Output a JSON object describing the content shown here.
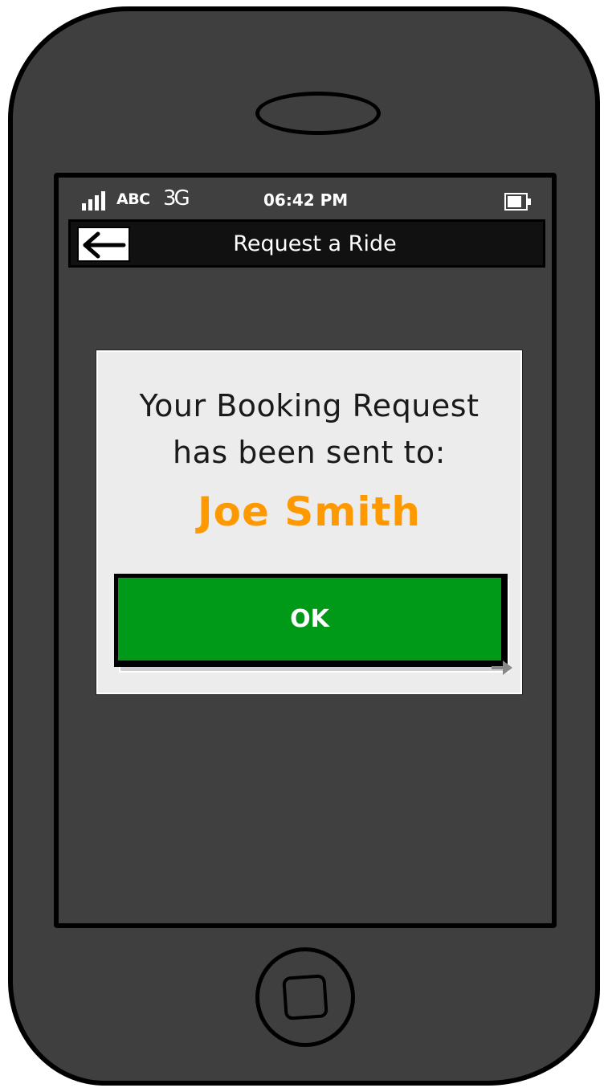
{
  "status_bar": {
    "carrier": "ABC",
    "network": "3G",
    "time": "06:42 PM",
    "icons": {
      "signal": "signal-bars-icon",
      "battery": "battery-icon"
    }
  },
  "nav": {
    "title": "Request a Ride",
    "back_icon": "arrow-left-icon"
  },
  "dialog": {
    "message_line1": "Your Booking Request",
    "message_line2": "has been sent to:",
    "recipient": "Joe Smith",
    "ok_label": "OK"
  },
  "colors": {
    "phone_body": "#3f3f3f",
    "ok_button": "#009a18",
    "recipient": "#ff9900",
    "dialog_bg": "#ececec"
  }
}
